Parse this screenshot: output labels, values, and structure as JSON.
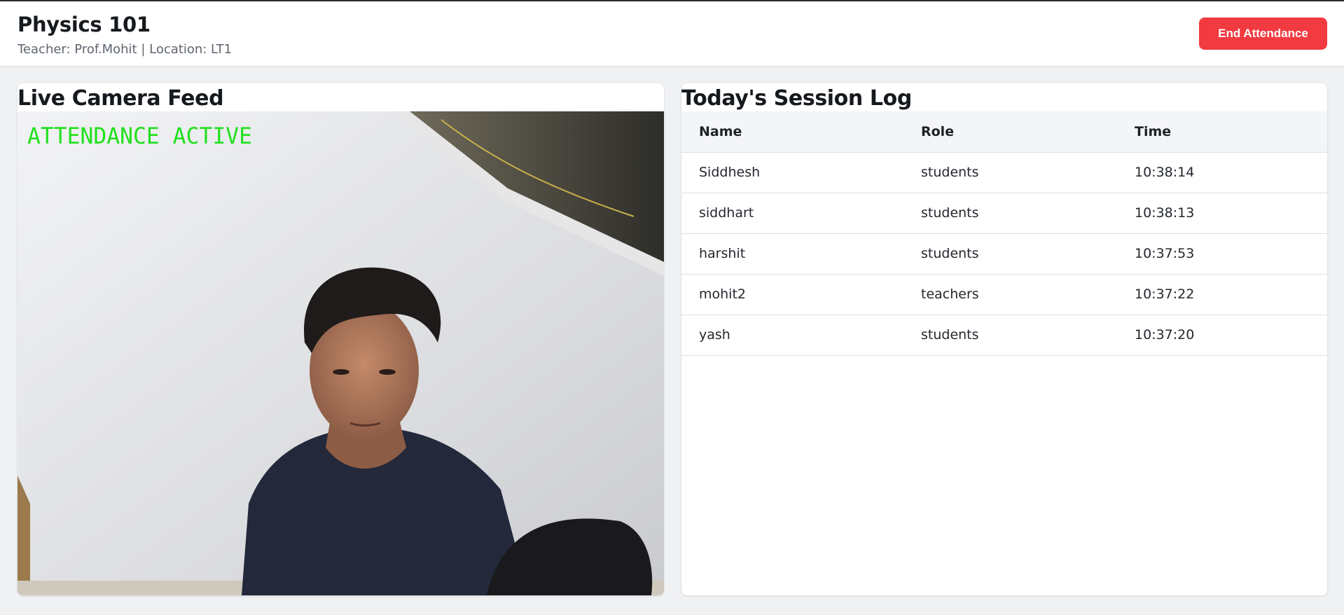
{
  "header": {
    "course_title": "Physics 101",
    "subtitle": "Teacher: Prof.Mohit | Location: LT1",
    "end_button_label": "End Attendance"
  },
  "camera": {
    "panel_title": "Live Camera Feed",
    "overlay_text": "ATTENDANCE ACTIVE",
    "overlay_color": "#21e01d"
  },
  "session_log": {
    "panel_title": "Today's Session Log",
    "columns": [
      "Name",
      "Role",
      "Time"
    ],
    "rows": [
      {
        "name": "Siddhesh",
        "role": "students",
        "time": "10:38:14"
      },
      {
        "name": "siddhart",
        "role": "students",
        "time": "10:38:13"
      },
      {
        "name": "harshit",
        "role": "students",
        "time": "10:37:53"
      },
      {
        "name": "mohit2",
        "role": "teachers",
        "time": "10:37:22"
      },
      {
        "name": "yash",
        "role": "students",
        "time": "10:37:20"
      }
    ]
  },
  "colors": {
    "accent_danger": "#f23b41",
    "background": "#f0f1f3"
  }
}
